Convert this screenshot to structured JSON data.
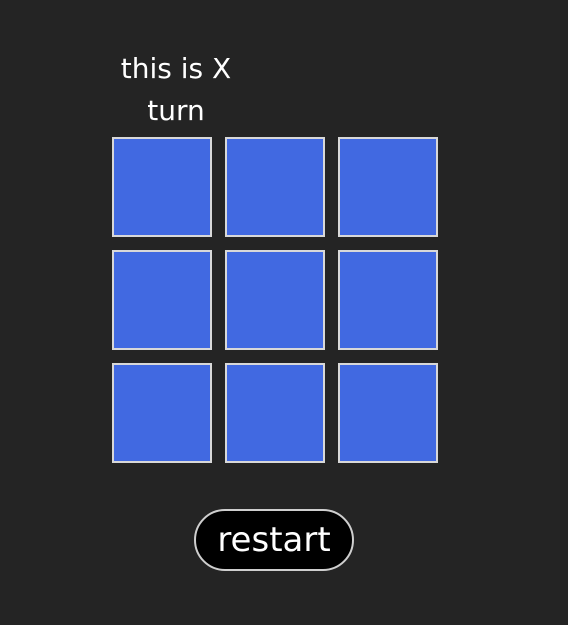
{
  "status_text": "this is X turn",
  "board": {
    "cells": [
      "",
      "",
      "",
      "",
      "",
      "",
      "",
      "",
      ""
    ]
  },
  "restart_label": "restart",
  "colors": {
    "background": "#242424",
    "cell": "#4169e1",
    "cell_border": "#d8d8d8",
    "button": "#000000",
    "text": "#ffffff"
  }
}
